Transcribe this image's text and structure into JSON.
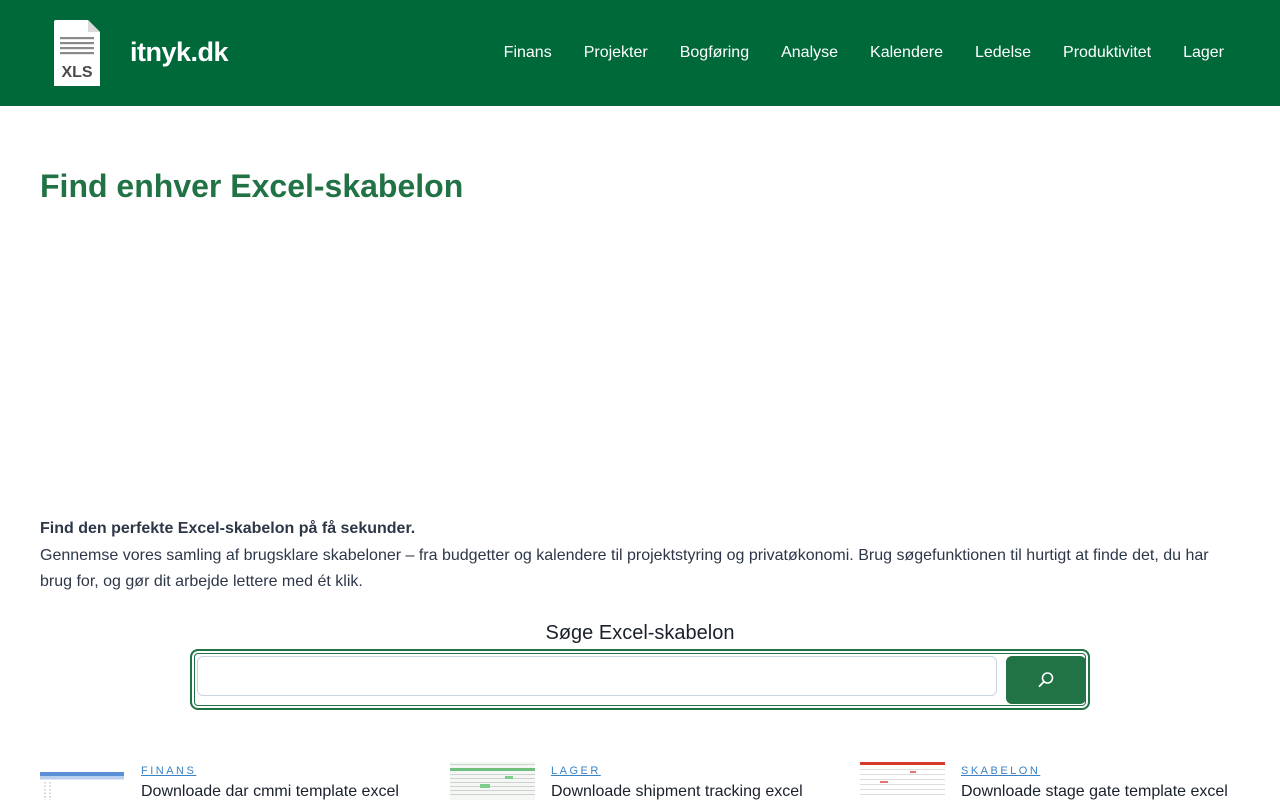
{
  "header": {
    "brand": "itnyk.dk",
    "logo_text": "XLS",
    "nav": [
      "Finans",
      "Projekter",
      "Bogføring",
      "Analyse",
      "Kalendere",
      "Ledelse",
      "Produktivitet",
      "Lager"
    ]
  },
  "main": {
    "title": "Find enhver Excel-skabelon",
    "intro_lead": "Find den perfekte Excel-skabelon på få sekunder.",
    "intro_body": "Gennemse vores samling af brugsklare skabeloner – fra budgetter og kalendere til projektstyring og privatøkonomi. Brug søgefunktionen til hurtigt at finde det, du har brug for, og gør dit arbejde lettere med ét klik.",
    "search_label": "Søge Excel-skabelon",
    "search_value": ""
  },
  "cards": [
    {
      "category": "FINANS",
      "title": "Downloade dar cmmi template excel"
    },
    {
      "category": "LAGER",
      "title": "Downloade shipment tracking excel"
    },
    {
      "category": "SKABELON",
      "title": "Downloade stage gate template excel"
    }
  ],
  "colors": {
    "header_bg": "#00693a",
    "accent": "#217346",
    "link": "#3b82c4"
  }
}
